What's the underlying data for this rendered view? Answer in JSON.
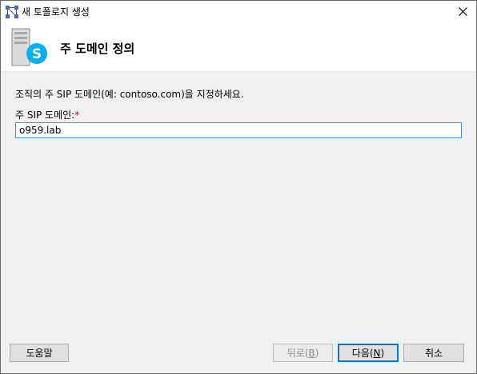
{
  "window": {
    "title": "새 토폴로지 생성"
  },
  "header": {
    "title": "주 도메인 정의"
  },
  "form": {
    "description": "조직의 주 SIP 도메인(예: contoso.com)을 지정하세요.",
    "domain_label": "주 SIP 도메인:",
    "required_marker": "*",
    "domain_value": "o959.lab"
  },
  "buttons": {
    "help": "도움말",
    "back_text": "뒤로(",
    "back_key": "B",
    "back_end": ")",
    "next_text": "다음(",
    "next_key": "N",
    "next_end": ")",
    "cancel": "취소"
  },
  "icons": {
    "app": "topology-builder-icon",
    "header": "skype-server-icon",
    "close": "close-icon"
  },
  "colors": {
    "skype_blue": "#00aff0",
    "focus_blue": "#0078d7",
    "required_red": "#cc0000"
  }
}
